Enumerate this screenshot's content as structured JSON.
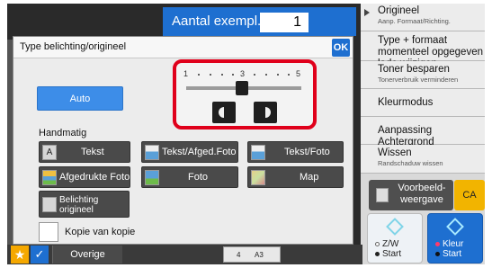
{
  "copies": {
    "label": "Aantal exempl.",
    "value": "1"
  },
  "right_panel": {
    "items": [
      {
        "label": "Origineel",
        "sub": "Aanp. Formaat/Richting."
      },
      {
        "label": "Type + formaat momenteel opgegeven lade wijzigen",
        "sub": ""
      },
      {
        "label": "Toner besparen",
        "sub": "Tonerverbruik verminderen"
      },
      {
        "label": "Kleurmodus",
        "sub": ""
      },
      {
        "label": "Aanpassing Achtergrond",
        "sub": ""
      },
      {
        "label": "Wissen",
        "sub": "Randschaduw wissen"
      }
    ],
    "preview_label": "Voorbeeld-weergave",
    "ca_label": "CA",
    "start_bw": {
      "line1": "Z/W",
      "line2": "Start"
    },
    "start_color": {
      "line1": "Kleur",
      "line2": "Start"
    }
  },
  "dialog": {
    "title": "Type belichting/origineel",
    "ok_label": "OK",
    "exposure_scale": [
      "1",
      "3",
      "5"
    ],
    "exposure_level": 3,
    "auto_label": "Auto",
    "handmatig_label": "Handmatig",
    "modes": [
      {
        "label": "Tekst",
        "icon": "text-a-icon"
      },
      {
        "label": "Tekst/Afged.Foto",
        "icon": "text-printed-photo-icon"
      },
      {
        "label": "Tekst/Foto",
        "icon": "text-photo-icon"
      },
      {
        "label": "Afgedrukte Foto",
        "icon": "printed-photo-icon"
      },
      {
        "label": "Foto",
        "icon": "photo-icon"
      },
      {
        "label": "Map",
        "icon": "map-icon"
      }
    ],
    "belichting_label": "Belichting origineel",
    "kopie_label": "Kopie van kopie"
  },
  "bottom_bar": {
    "overige_label": "Overige",
    "tray_number": "4",
    "tray_size": "A3"
  },
  "colors": {
    "accent_blue": "#1e6fd0",
    "auto_blue": "#3d8de8",
    "highlight_red": "#e0001b",
    "ca_yellow": "#f2b400",
    "star_orange": "#f5a800"
  }
}
